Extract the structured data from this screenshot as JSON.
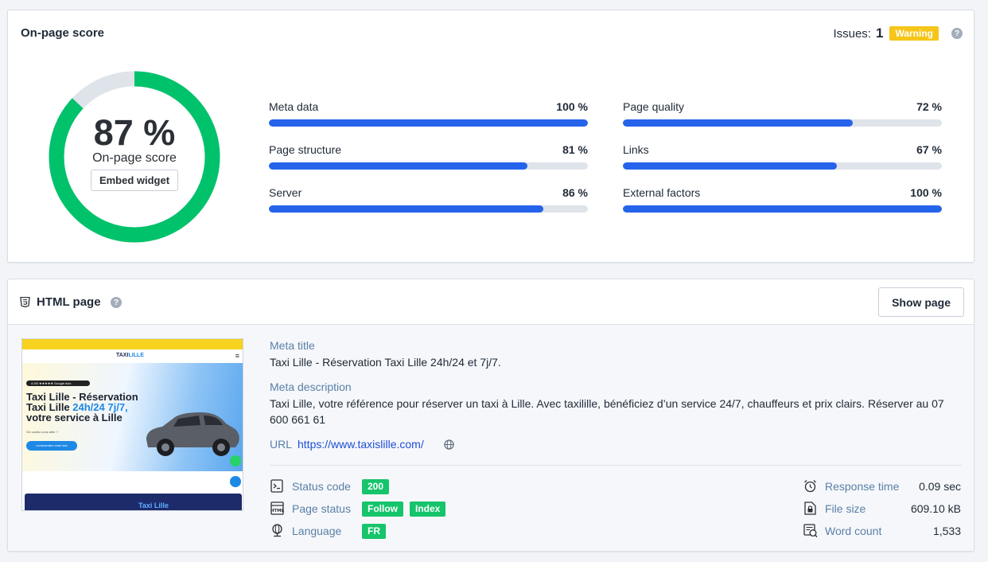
{
  "score_card": {
    "title": "On-page score",
    "issues_label": "Issues:",
    "issues_count": "1",
    "issues_badge": "Warning",
    "score_value": "87 %",
    "score_percent": 87,
    "score_label": "On-page score",
    "embed_label": "Embed widget",
    "colors": {
      "score_green": "#00c26b",
      "track": "#dfe3ea",
      "bar_blue": "#2563eb",
      "warning": "#f5c518"
    },
    "metrics": [
      {
        "name": "Meta data",
        "value": "100 %",
        "percent": 100
      },
      {
        "name": "Page quality",
        "value": "72 %",
        "percent": 72
      },
      {
        "name": "Page structure",
        "value": "81 %",
        "percent": 81
      },
      {
        "name": "Links",
        "value": "67 %",
        "percent": 67
      },
      {
        "name": "Server",
        "value": "86 %",
        "percent": 86
      },
      {
        "name": "External factors",
        "value": "100 %",
        "percent": 100
      }
    ]
  },
  "html_card": {
    "title": "HTML page",
    "show_page_label": "Show page",
    "thumbnail": {
      "logo_a": "TAXI",
      "logo_b": "LILLE",
      "headline_1": "Taxi Lille - Réservation",
      "headline_2a": "Taxi Lille ",
      "headline_2b": "24h/24 7j/7,",
      "headline_3": "votre service à Lille",
      "question": "Où voulez-vous aller ?",
      "cta": "commandez votre taxi",
      "pill": "4.9/5 ★★★★★ Google Avis",
      "dark_title": "Taxi Lille"
    },
    "meta_title_label": "Meta title",
    "meta_title_value": "Taxi Lille - Réservation Taxi Lille 24h/24 et 7j/7.",
    "meta_desc_label": "Meta description",
    "meta_desc_value": "Taxi Lille, votre référence pour réserver un taxi à Lille. Avec taxilille, bénéficiez d’un service 24/7, chauffeurs et prix clairs. Réserver au 07 600 661 61",
    "url_label": "URL",
    "url_value": "https://www.taxislille.com/",
    "status_code_label": "Status code",
    "status_code_value": "200",
    "page_status_label": "Page status",
    "page_status_follow": "Follow",
    "page_status_index": "Index",
    "language_label": "Language",
    "language_value": "FR",
    "response_time_label": "Response time",
    "response_time_value": "0.09 sec",
    "file_size_label": "File size",
    "file_size_value": "609.10 kB",
    "word_count_label": "Word count",
    "word_count_value": "1,533"
  }
}
